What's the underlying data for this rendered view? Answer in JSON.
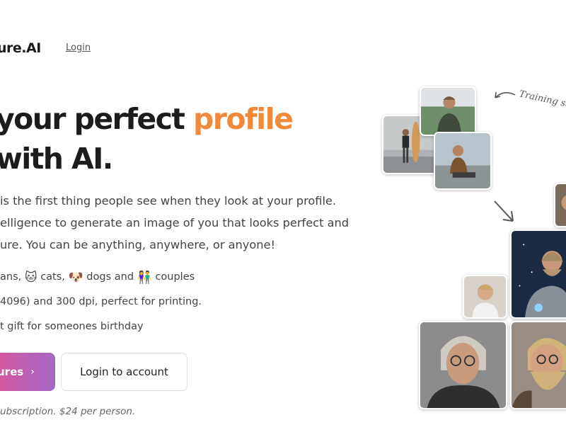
{
  "nav": {
    "brand": "ure.AI",
    "login": "Login"
  },
  "hero": {
    "headline_line1_pre": "your perfect ",
    "headline_line1_accent": "profile",
    "headline_line2": "with AI.",
    "paragraph": [
      "is the first thing people see when they look at your profile.",
      "elligence to generate an image of you that looks perfect and",
      "ure. You can be anything, anywhere, or anyone!"
    ],
    "features": {
      "f1": {
        "prefix": "ans, ",
        "cat_icon": "🐱",
        "cats": " cats, ",
        "dog_icon": "🐶",
        "dogs": " dogs and ",
        "couple_icon": "👫",
        "couples": " couples"
      },
      "f2": "4096) and 300 dpi, perfect for printing.",
      "f3": "t gift for someones birthday"
    },
    "primary_button": "ures",
    "primary_chevron": "›",
    "secondary_button": "Login to account",
    "footnote": "ubscription. $24 per person."
  },
  "annotations": {
    "training": "Training se"
  },
  "colors": {
    "accent": "#f08a3a",
    "button_start": "#d9569a",
    "button_end": "#a467c5"
  }
}
